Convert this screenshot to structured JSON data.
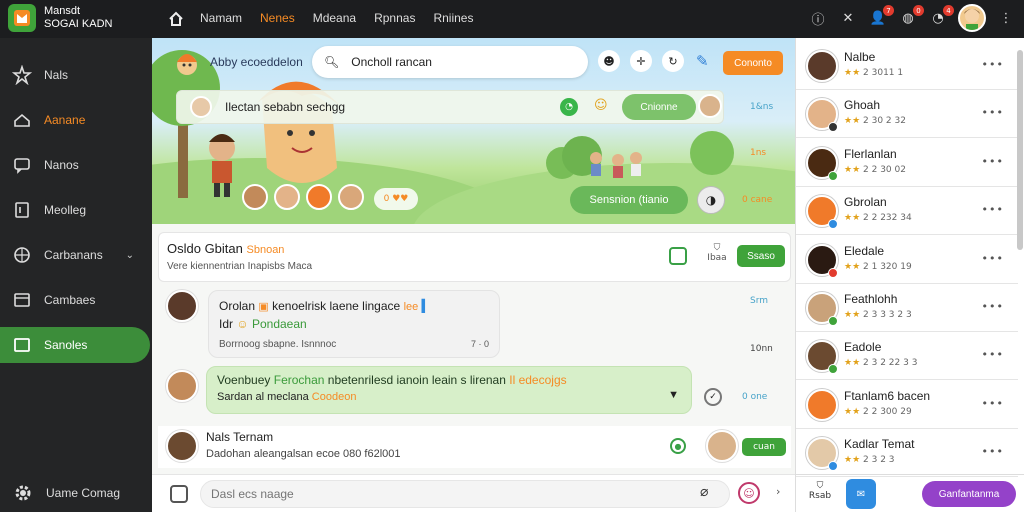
{
  "app": {
    "title_line1": "Mansdt",
    "title_line2": "SOGAI KADN"
  },
  "topnav": {
    "items": [
      {
        "label": "Namam",
        "active": false
      },
      {
        "label": "Nenes",
        "active": true
      },
      {
        "label": "Mdeana",
        "active": false
      },
      {
        "label": "Rpnnas",
        "active": false
      },
      {
        "label": "Rniines",
        "active": false
      }
    ]
  },
  "topicons": {
    "badges": [
      "7",
      "0",
      "4"
    ]
  },
  "sidebar": {
    "items": [
      {
        "label": "Nals",
        "icon": "star-icon"
      },
      {
        "label": "Aanane",
        "icon": "inbox-icon",
        "highlight": true
      },
      {
        "label": "Nanos",
        "icon": "chat-icon"
      },
      {
        "label": "Meolleg",
        "icon": "bookmark-icon"
      },
      {
        "label": "Carbanans",
        "icon": "network-icon",
        "expand": true
      },
      {
        "label": "Cambaes",
        "icon": "window-icon"
      },
      {
        "label": "Sanoles",
        "icon": "folder-icon",
        "active": true
      }
    ],
    "footer": "Uame Comag"
  },
  "hero": {
    "title": "Abby ecoeddelon",
    "search_value": "Oncholl rancan",
    "orange_btn": "Cononto",
    "bar_text": "Ilectan sebabn sechgg",
    "bar_btn": "Cnionne",
    "time1": "1&ns",
    "time2": "1ns",
    "time3": "0 cane",
    "reacts": "0 ♥♥",
    "green_btn": "Sensnion (tianio"
  },
  "post": {
    "title": "Osldo Gbitan",
    "title_tag": "Sbnoan",
    "subtitle": "Vere kiennentrian Inapisbs Maca",
    "icon_label": "Ibaa",
    "button": "Ssaso"
  },
  "messages": [
    {
      "line1": "Orolan",
      "line1_tag": "kenoelrisk laene lingace",
      "line1_tag2": "lee",
      "line2a": "Idr",
      "line2b": "Pondaean",
      "line3": "Borrnoog sbapne. Isnnnoc",
      "line3_right": "7 · 0",
      "time_a": "Srm",
      "time_b": "10nn"
    },
    {
      "line1": "Voenbuey",
      "line1_g": "Ferochan",
      "line1_rest": "nbetenrilesd ianoin leain s lirenan",
      "line1_o": "Il edecojgs",
      "line2": "Sardan al meclana",
      "line2_o": "Coodeon",
      "time": "0 one"
    },
    {
      "name": "Nals Ternam",
      "sub": "Dadohan aleangalsan ecoe 080 f62l001",
      "btn": "cuan"
    }
  ],
  "composer": {
    "placeholder": "Dasl ecs naage"
  },
  "contacts": [
    {
      "name": "Nalbe",
      "meta": "2 3011 1",
      "dot": ""
    },
    {
      "name": "Ghoah",
      "meta": "2 30 2 32",
      "dot": "#333"
    },
    {
      "name": "Flerlanlan",
      "meta": "2 2 30 02",
      "dot": "#3fa33a"
    },
    {
      "name": "Gbrolan",
      "meta": "2 2 232 34",
      "dot": "#2f8ce0"
    },
    {
      "name": "Eledale",
      "meta": "2 1 320 19",
      "dot": "#e23b2e"
    },
    {
      "name": "Feathlohh",
      "meta": "2 3 3 3 2 3",
      "dot": "#3fa33a"
    },
    {
      "name": "Eadole",
      "meta": "2 3 2 22 3 3",
      "dot": "#3fa33a"
    },
    {
      "name": "Ftanlam6 bacen",
      "meta": "2 2 300 29",
      "dot": ""
    },
    {
      "name": "Kadlar Temat",
      "meta": "2 3 2 3",
      "dot": "#2f8ce0"
    }
  ],
  "rfooter": {
    "icon_label": "Rsab",
    "button": "Ganfantanma"
  }
}
